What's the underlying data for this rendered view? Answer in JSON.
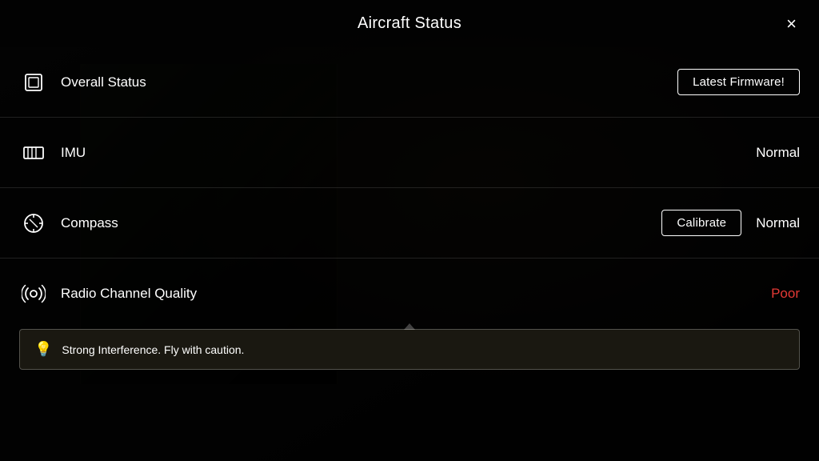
{
  "header": {
    "title": "Aircraft Status",
    "close_label": "×"
  },
  "rows": [
    {
      "id": "overall-status",
      "label": "Overall Status",
      "icon": "device-icon",
      "action_label": "Latest Firmware!",
      "value": null,
      "value_class": ""
    },
    {
      "id": "imu",
      "label": "IMU",
      "icon": "imu-icon",
      "action_label": null,
      "value": "Normal",
      "value_class": ""
    },
    {
      "id": "compass",
      "label": "Compass",
      "icon": "compass-icon",
      "action_label": "Calibrate",
      "value": "Normal",
      "value_class": ""
    },
    {
      "id": "radio-channel",
      "label": "Radio Channel Quality",
      "icon": "radio-icon",
      "action_label": null,
      "value": "Poor",
      "value_class": "poor"
    }
  ],
  "warning": {
    "icon": "lightbulb-icon",
    "text": "Strong Interference. Fly with caution."
  }
}
